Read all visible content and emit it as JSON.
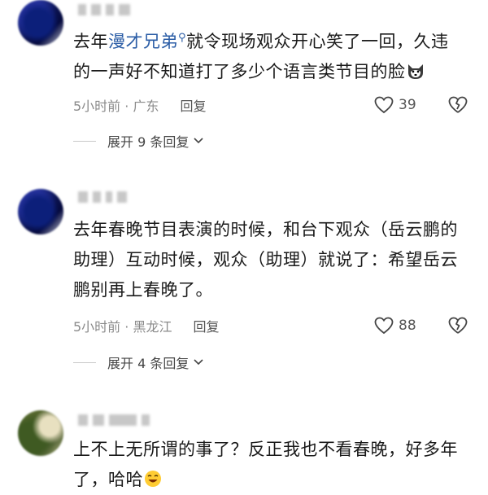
{
  "comments": [
    {
      "text_before": "去年",
      "link": "漫才兄弟",
      "text_after": "就令现场观众开心笑了一回，久违的一声好不知道打了多少个语言类节目的脸",
      "emoji_name": "dog-face-emoji",
      "time_location": "5小时前 · 广东",
      "reply_label": "回复",
      "likes": "39",
      "expand_label": "展开 9 条回复"
    },
    {
      "text": "去年春晚节目表演的时候，和台下观众（岳云鹏的助理）互动时候，观众（助理）就说了：希望岳云鹏别再上春晚了。",
      "time_location": "5小时前 · 黑龙江",
      "reply_label": "回复",
      "likes": "88",
      "expand_label": "展开 4 条回复"
    },
    {
      "text": "上不上无所谓的事了？反正我也不看春晚，好多年了，哈哈",
      "emoji_name": "laughing-emoji"
    }
  ],
  "icons": {
    "like": "heart-outline-icon",
    "dislike": "broken-heart-icon",
    "expand": "chevron-down-icon",
    "link": "search-link-icon"
  },
  "colors": {
    "link": "#2b5da6",
    "meta": "#8a8a8a"
  }
}
